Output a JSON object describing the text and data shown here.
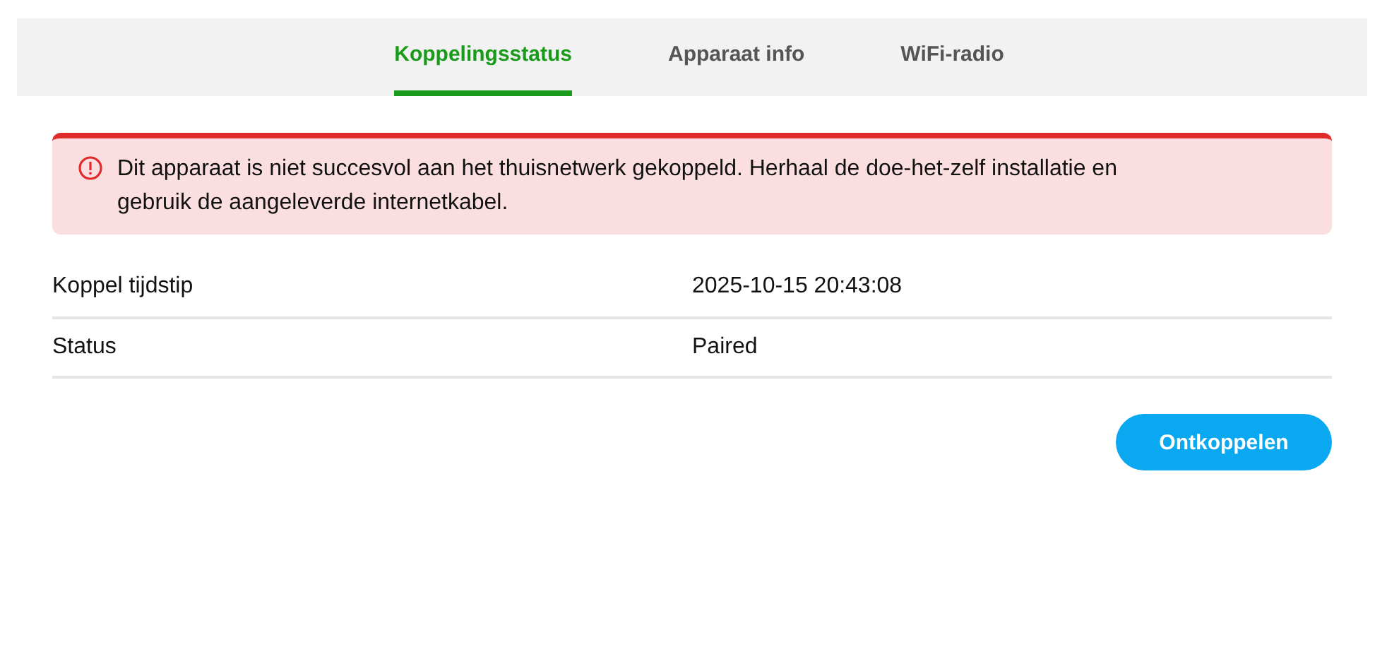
{
  "tabs": [
    {
      "label": "Koppelingsstatus",
      "selected": true
    },
    {
      "label": "Apparaat info",
      "selected": false
    },
    {
      "label": "WiFi-radio",
      "selected": false
    }
  ],
  "alert": {
    "kind": "error",
    "message": "Dit apparaat is niet succesvol aan het thuisnetwerk gekoppeld. Herhaal de doe-het-zelf installatie en gebruik de aangeleverde internetkabel."
  },
  "details": [
    {
      "label": "Koppel tijdstip",
      "value": "2025-10-15 20:43:08"
    },
    {
      "label": "Status",
      "value": "Paired"
    }
  ],
  "buttons": [
    "Ontkoppelen"
  ]
}
